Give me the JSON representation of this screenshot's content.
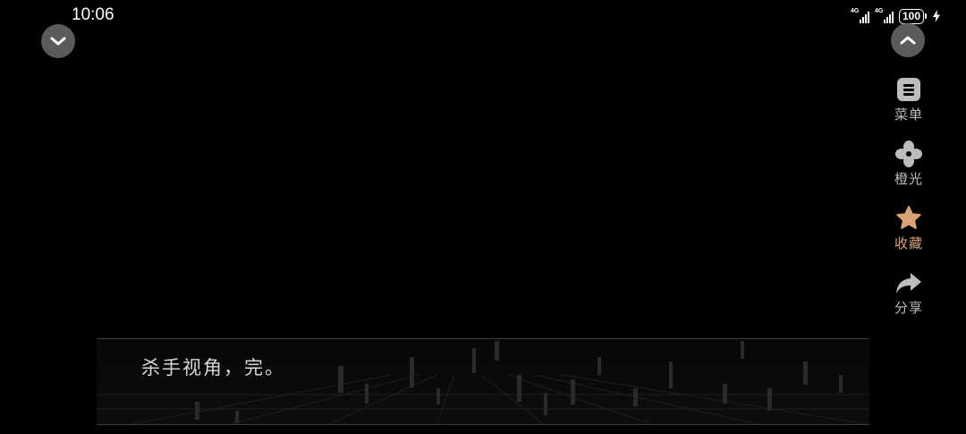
{
  "status_bar": {
    "time": "10:06",
    "network_1": "4G",
    "network_2": "4G",
    "battery": "100"
  },
  "controls": {
    "collapse_icon": "chevron-down-icon",
    "expand_icon": "chevron-up-icon"
  },
  "side_menu": {
    "items": [
      {
        "label": "菜单",
        "icon": "menu-icon",
        "color": "#bdbdbd"
      },
      {
        "label": "橙光",
        "icon": "fan-icon",
        "color": "#bdbdbd"
      },
      {
        "label": "收藏",
        "icon": "star-icon",
        "color": "#d8a373"
      },
      {
        "label": "分享",
        "icon": "share-icon",
        "color": "#bdbdbd"
      }
    ]
  },
  "dialogue": {
    "text": "杀手视角，完。"
  }
}
